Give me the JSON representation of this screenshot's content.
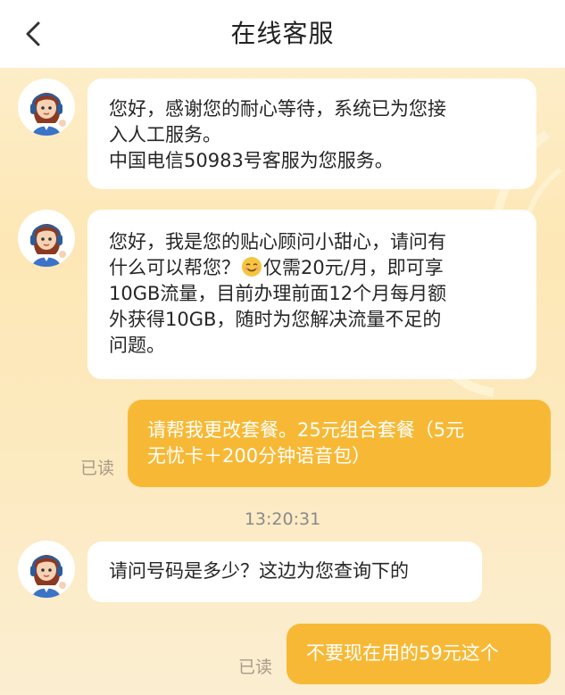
{
  "header": {
    "title": "在线客服"
  },
  "messages": [
    {
      "sender": "agent",
      "lines": [
        "您好，感谢您的耐心等待，系统已为您接",
        "入人工服务。",
        "中国电信50983号客服为您服务。"
      ]
    },
    {
      "sender": "agent",
      "line1": "您好，我是您的贴心顾问小甜心，请问有",
      "line2_before_emoji": "什么可以帮您？",
      "line2_after_emoji": "仅需20元/月，即可享",
      "line3": "10GB流量，目前办理前面12个月每月额",
      "line4": "外获得10GB，随时为您解决流量不足的",
      "line5": "问题。"
    },
    {
      "sender": "user",
      "lines": [
        "请帮我更改套餐。25元组合套餐（5元",
        "无忧卡＋200分钟语音包）"
      ],
      "status": "已读"
    },
    {
      "sender": "agent",
      "lines": [
        "请问号码是多少？这边为您查询下的"
      ]
    },
    {
      "sender": "user",
      "lines": [
        "不要现在用的59元这个"
      ],
      "status": "已读"
    }
  ],
  "timestamp": "13:20:31",
  "icons": {
    "back": "chevron-left-icon",
    "avatar": "customer-service-agent-avatar",
    "emoji": "smiling-face-emoji"
  },
  "colors": {
    "user_bubble": "#f7b935",
    "agent_bubble": "#ffffff",
    "read_status": "#a69a8a"
  }
}
